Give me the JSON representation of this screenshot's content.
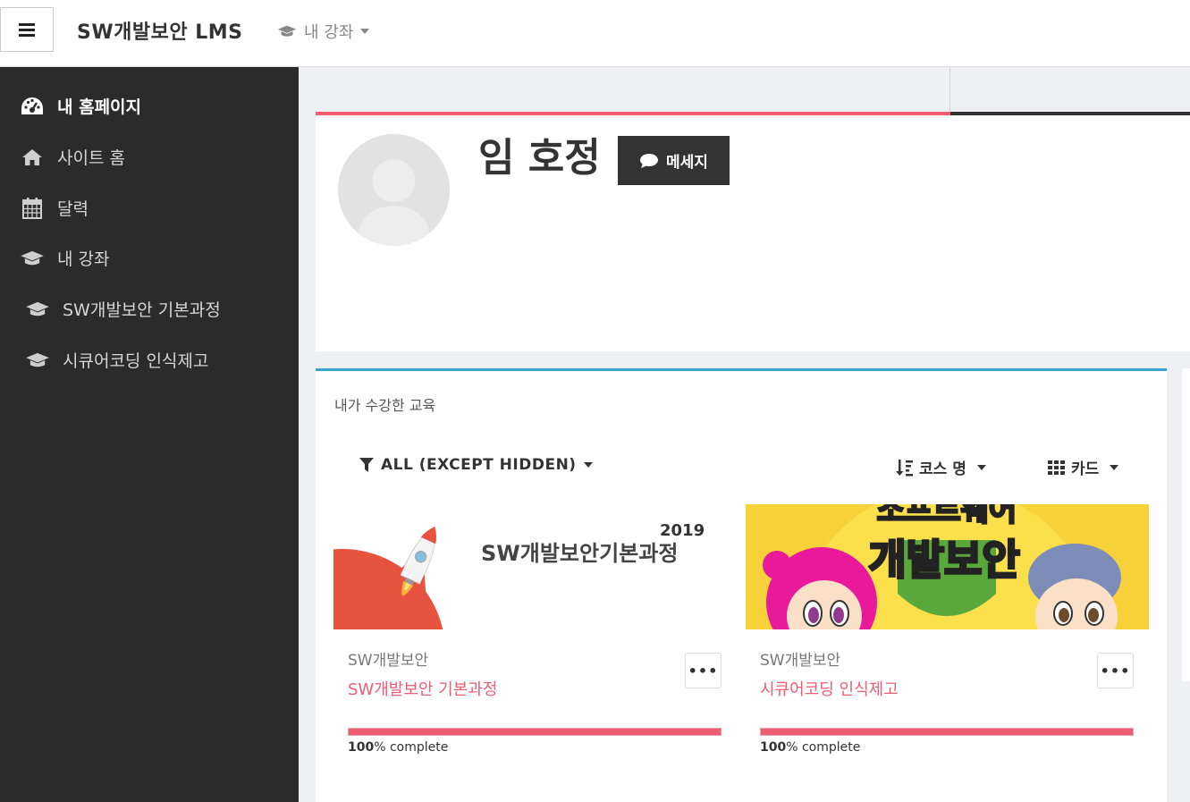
{
  "header": {
    "site_title": "SW개발보안 LMS",
    "courses_menu": "내 강좌"
  },
  "sidebar": {
    "items": [
      {
        "label": "내 홈페이지",
        "icon": "dashboard-icon",
        "active": true
      },
      {
        "label": "사이트 홈",
        "icon": "home-icon"
      },
      {
        "label": "달력",
        "icon": "calendar-icon"
      },
      {
        "label": "내 강좌",
        "icon": "graduation-cap-icon"
      },
      {
        "label": "SW개발보안 기본과정",
        "icon": "graduation-cap-icon"
      },
      {
        "label": "시큐어코딩 인식제고",
        "icon": "graduation-cap-icon"
      }
    ]
  },
  "profile": {
    "name": "임 호정",
    "message_button": "메세지"
  },
  "courses": {
    "title": "내가 수강한 교육",
    "filter_label": "ALL (EXCEPT HIDDEN)",
    "sort_label": "코스 명",
    "view_label": "카드",
    "more_label": "•••",
    "items": [
      {
        "category": "SW개발보안",
        "name": "SW개발보안 기본과정",
        "banner_year": "2019",
        "banner_title": "SW개발보안기본과정",
        "progress": 100,
        "progress_percent": "100",
        "progress_suffix": "% complete"
      },
      {
        "category": "SW개발보안",
        "name": "시큐어코딩 인식제고",
        "banner_top": "소프트웨어",
        "banner_title": "개발보안",
        "progress": 100,
        "progress_percent": "100",
        "progress_suffix": "% complete"
      }
    ]
  },
  "colors": {
    "accent_pink": "#ef5d73",
    "accent_blue": "#3aa3d4",
    "sidebar_bg": "#2b2b2b"
  }
}
